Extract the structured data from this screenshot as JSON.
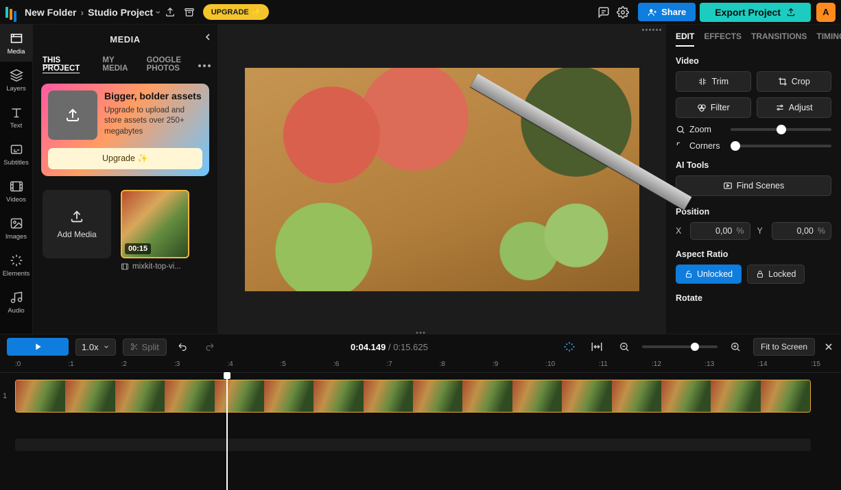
{
  "colors": {
    "accent_blue": "#0f7ddd",
    "accent_teal": "#1cccc0",
    "upgrade_yellow": "#f4c52a",
    "avatar_orange": "#ff8a1e"
  },
  "breadcrumb": {
    "folder": "New Folder",
    "project": "Studio Project"
  },
  "topbar": {
    "upgrade_label": "UPGRADE",
    "share_label": "Share",
    "export_label": "Export Project",
    "avatar_letter": "A"
  },
  "rail": {
    "media": "Media",
    "layers": "Layers",
    "text": "Text",
    "subtitles": "Subtitles",
    "videos": "Videos",
    "images": "Images",
    "elements": "Elements",
    "audio": "Audio"
  },
  "media_panel": {
    "title": "MEDIA",
    "tabs": {
      "this_project": "THIS PROJECT",
      "my_media": "MY MEDIA",
      "google_photos": "GOOGLE PHOTOS"
    },
    "promo_title": "Bigger, bolder assets",
    "promo_body": "Upgrade to upload and store assets over 250+ megabytes",
    "promo_cta": "Upgrade ✨",
    "add_media": "Add Media",
    "clip": {
      "duration": "00:15",
      "filename": "mixkit-top-vi..."
    }
  },
  "right_panel": {
    "tabs": {
      "edit": "EDIT",
      "effects": "EFFECTS",
      "transitions": "TRANSITIONS",
      "timing": "TIMING"
    },
    "video_label": "Video",
    "trim": "Trim",
    "crop": "Crop",
    "filter": "Filter",
    "adjust": "Adjust",
    "zoom_label": "Zoom",
    "zoom_pos_pct": 50,
    "corners_label": "Corners",
    "corners_pos_pct": 5,
    "ai_tools_label": "AI Tools",
    "find_scenes": "Find Scenes",
    "position_label": "Position",
    "pos_x": "0,00",
    "pos_y": "0,00",
    "pos_unit": "%",
    "aspect_label": "Aspect Ratio",
    "unlocked": "Unlocked",
    "locked": "Locked",
    "rotate_label": "Rotate"
  },
  "timeline": {
    "speed_label": "1.0x",
    "split_label": "Split",
    "current": "0:04.149",
    "total": "0:15.625",
    "fit_label": "Fit to Screen",
    "ruler_marks": [
      ":0",
      ":1",
      ":2",
      ":3",
      ":4",
      ":5",
      ":6",
      ":7",
      ":8",
      ":9",
      ":10",
      ":11",
      ":12",
      ":13",
      ":14",
      ":15"
    ],
    "track_number": "1"
  }
}
